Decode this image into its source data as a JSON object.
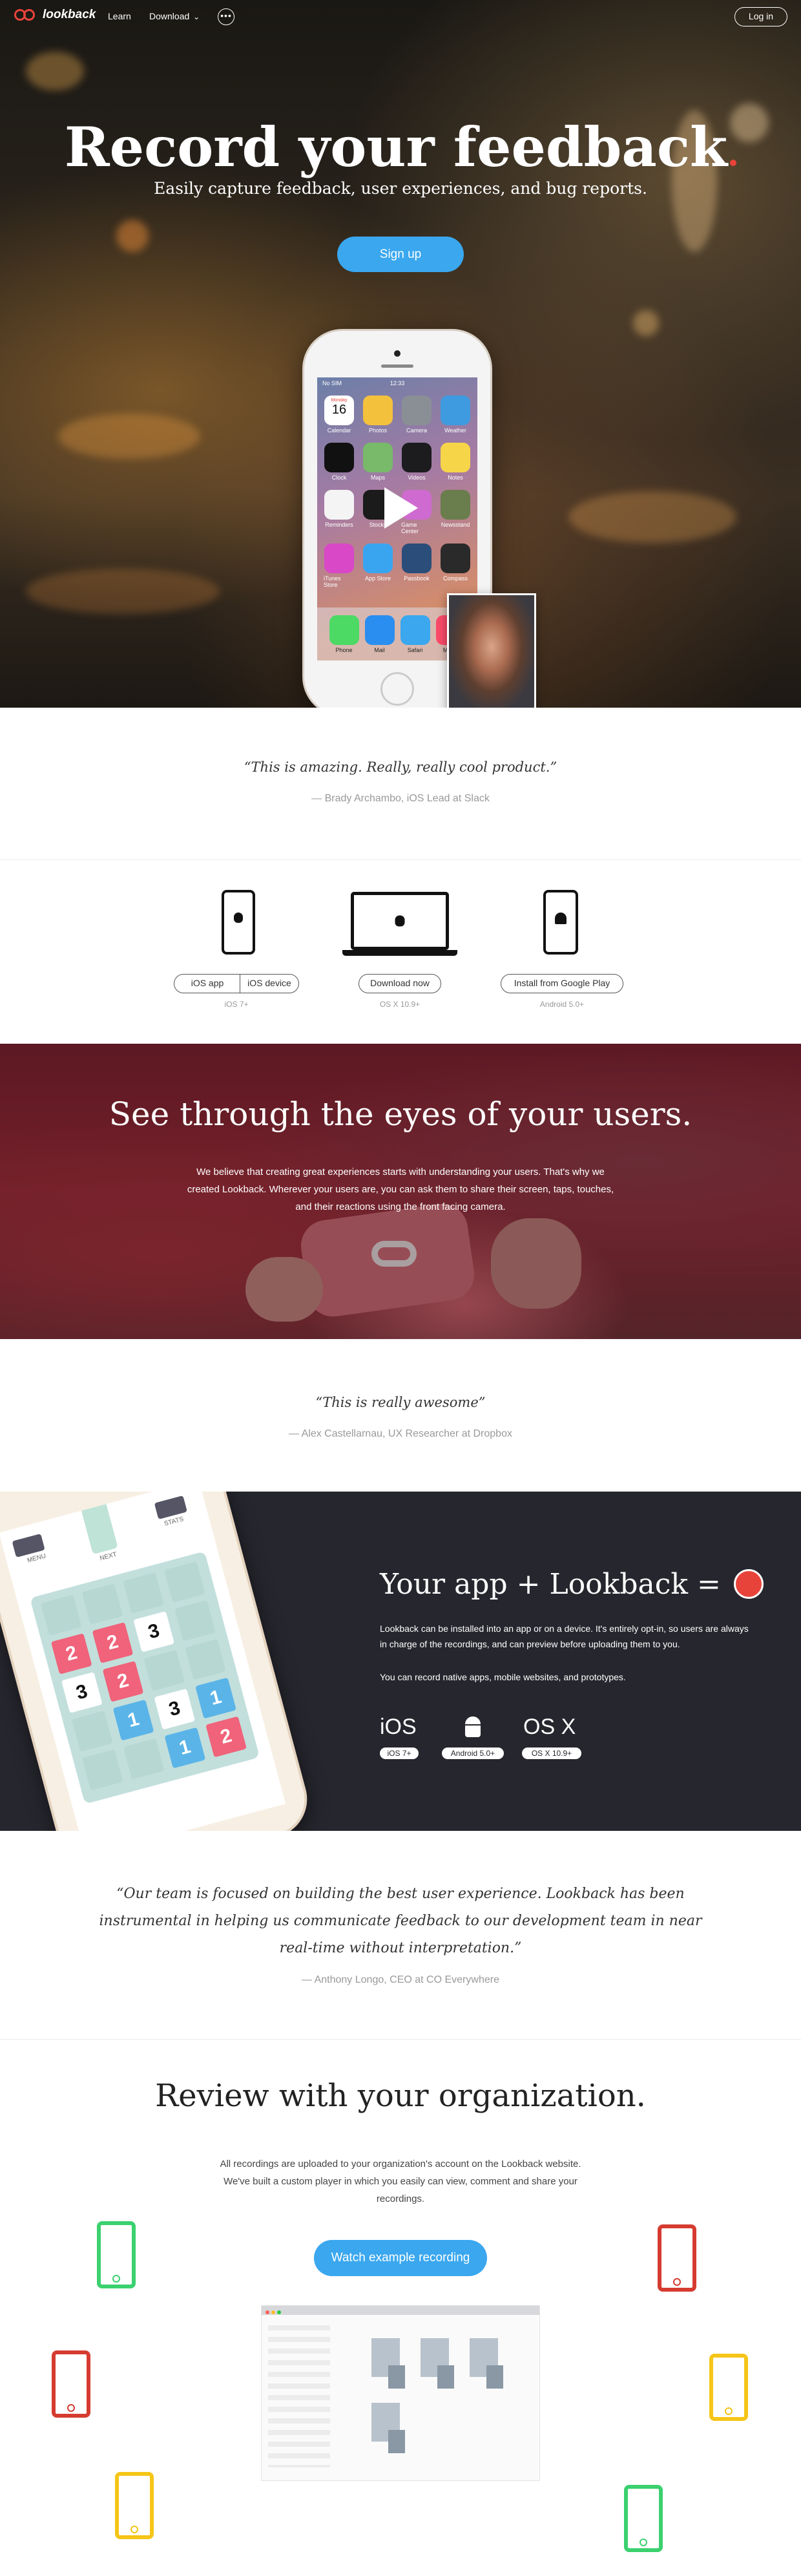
{
  "nav": {
    "logo": "lookback",
    "learn": "Learn",
    "download": "Download",
    "download_caret": "⌄",
    "more": "•••",
    "login": "Log in"
  },
  "hero": {
    "title": "Record your feedback",
    "subtitle": "Easily capture feedback, user experiences, and bug reports.",
    "cta": "Sign up",
    "phone_status_left": "No SIM",
    "phone_status_time": "12:33",
    "calendar_day": "Monday",
    "calendar_date": "16",
    "apps": [
      {
        "label": "Calendar",
        "color": "#ffffff"
      },
      {
        "label": "Photos",
        "color": "#f4c13d"
      },
      {
        "label": "Camera",
        "color": "#8a8f96"
      },
      {
        "label": "Weather",
        "color": "#3f9be0"
      },
      {
        "label": "Clock",
        "color": "#111111"
      },
      {
        "label": "Maps",
        "color": "#78b96a"
      },
      {
        "label": "Videos",
        "color": "#1c1c1e"
      },
      {
        "label": "Notes",
        "color": "#f7d548"
      },
      {
        "label": "Reminders",
        "color": "#f4f4f4"
      },
      {
        "label": "Stocks",
        "color": "#1b1b1b"
      },
      {
        "label": "Game Center",
        "color": "#cf6bd0"
      },
      {
        "label": "Newsstand",
        "color": "#6a7d4c"
      },
      {
        "label": "iTunes Store",
        "color": "#d848c7"
      },
      {
        "label": "App Store",
        "color": "#39a5f1"
      },
      {
        "label": "Passbook",
        "color": "#2b4d7a"
      },
      {
        "label": "Compass",
        "color": "#2a2a2a"
      }
    ],
    "dock": [
      {
        "label": "Phone",
        "color": "#4cd964"
      },
      {
        "label": "Mail",
        "color": "#2a8ef0"
      },
      {
        "label": "Safari",
        "color": "#3aa7ef"
      },
      {
        "label": "Music",
        "color": "#fb4b6a"
      }
    ]
  },
  "quote1": {
    "text": "“This is amazing. Really, really cool product.”",
    "cite": "— Brady Archambo, iOS Lead at Slack"
  },
  "downloads": {
    "ios_app": "iOS app",
    "ios_device": "iOS device",
    "ios_req": "iOS 7+",
    "mac_btn": "Download now",
    "mac_req": "OS X 10.9+",
    "android_btn": "Install from Google Play",
    "android_req": "Android 5.0+"
  },
  "eyes": {
    "title": "See through the eyes of your users.",
    "body": "We believe that creating great experiences starts with understanding your users. That's why we created Lookback. Wherever your users are, you can ask them to share their screen, taps, touches, and their reactions using the front facing camera."
  },
  "quote2": {
    "text": "“This is really awesome”",
    "cite": "— Alex Castellarnau, UX Researcher at Dropbox"
  },
  "app_section": {
    "title": "Your app + Lookback =",
    "para1": "Lookback can be installed into an app or on a device. It's entirely opt-in, so users are always in charge of the recordings, and can preview before uploading them to you.",
    "para2": "You can record native apps, mobile websites, and prototypes.",
    "game_labels": [
      "MENU",
      "NEXT",
      "STATS"
    ],
    "board": [
      [
        "",
        "",
        "",
        ""
      ],
      [
        "2",
        "2",
        "3",
        ""
      ],
      [
        "3",
        "2",
        "",
        ""
      ],
      [
        "",
        "1",
        "3",
        "1"
      ],
      [
        "",
        "",
        "1",
        "2"
      ]
    ],
    "platforms": [
      {
        "name": "iOS",
        "badge": "iOS 7+"
      },
      {
        "name": "",
        "badge": "Android 5.0+"
      },
      {
        "name": "OS X",
        "badge": "OS X 10.9+"
      }
    ],
    "accent": "#e8433a"
  },
  "quote3": {
    "text": "“Our team is focused on building the best user experience. Lookback has been instrumental in helping us communicate feedback to our development team in near real-time without interpretation.”",
    "cite": "— Anthony Longo, CEO at CO Everywhere"
  },
  "review": {
    "title": "Review with your organization.",
    "body": "All recordings are uploaded to your organization's account on the Lookback website. We've built a custom player in which you easily can view, comment and share your recordings.",
    "cta": "Watch example recording"
  },
  "colors": {
    "brand_red": "#e8433a",
    "cta_blue": "#3aa7ef",
    "dark_band": "#26262e"
  }
}
